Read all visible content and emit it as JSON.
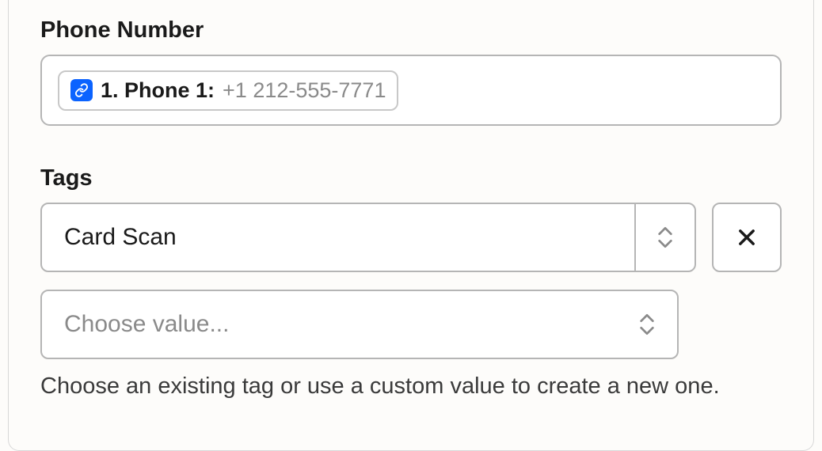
{
  "phone": {
    "label": "Phone Number",
    "token": {
      "label": "1. Phone 1:",
      "value": "+1 212-555-7771"
    }
  },
  "tags": {
    "label": "Tags",
    "selected": "Card Scan",
    "placeholder": "Choose value...",
    "help": "Choose an existing tag or use a custom value to create a new one."
  }
}
